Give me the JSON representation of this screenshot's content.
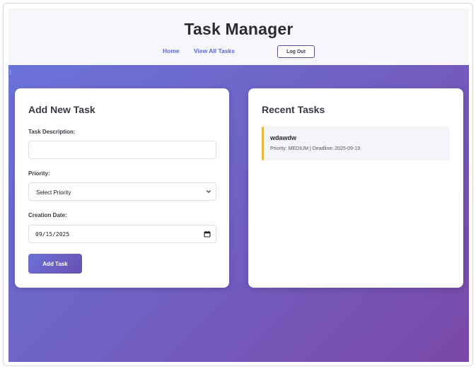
{
  "header": {
    "title": "Task Manager",
    "nav": [
      {
        "label": "Home"
      },
      {
        "label": "View All Tasks"
      }
    ],
    "logout_label": "Log Out"
  },
  "add_task": {
    "title": "Add New Task",
    "description_label": "Task Description:",
    "description_value": "",
    "priority_label": "Priority:",
    "priority_selected": "Select Priority",
    "date_label": "Creation Date:",
    "date_value": "09/15/2025",
    "submit_label": "Add Task"
  },
  "recent_tasks": {
    "title": "Recent Tasks",
    "items": [
      {
        "name": "wdawdw",
        "meta": "Priority: MEDIUM | Deadline: 2025-09-19",
        "accent_color": "#f0b34a"
      }
    ]
  },
  "colors": {
    "accent": "#5b66d6",
    "gradient_start": "#6a75dd",
    "gradient_end": "#7a48a8"
  },
  "icons": {
    "select_arrow": "chevron-down-icon",
    "date_picker": "calendar-icon"
  }
}
